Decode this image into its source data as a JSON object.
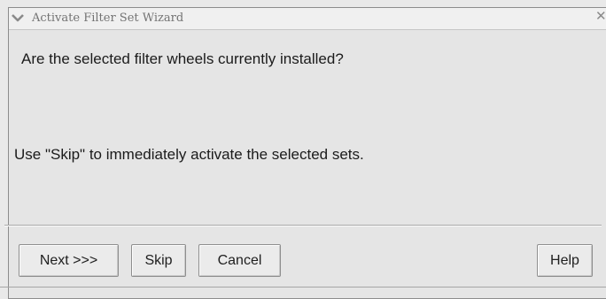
{
  "window": {
    "title": "Activate Filter Set Wizard"
  },
  "dialog": {
    "question": "Are the selected filter wheels currently installed?",
    "hint": "Use \"Skip\" to immediately activate the selected sets."
  },
  "buttons": {
    "next": "Next >>>",
    "skip": "Skip",
    "cancel": "Cancel",
    "help": "Help"
  },
  "icons": {
    "title_menu": "chevron-down-icon",
    "title_close": "close-icon"
  }
}
